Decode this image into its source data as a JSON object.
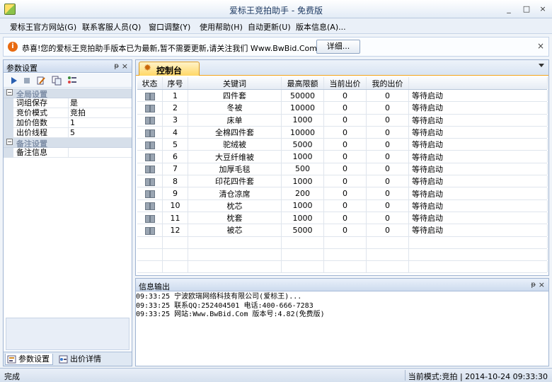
{
  "window": {
    "title": "爱标王竞拍助手 - 免费版",
    "minimize": "_",
    "maximize": "□",
    "close": "×"
  },
  "menu": [
    "爱标王官方网站(G)",
    "联系客服人员(Q)",
    "窗口调整(Y)",
    "使用帮助(H)",
    "自动更新(U)",
    "版本信息(A)..."
  ],
  "info_bar": {
    "icon": "info-icon",
    "text": "恭喜!您的爱标王竞拍助手版本已为最新,暂不需要更新,请关注我们 Www.BwBid.Com",
    "detail_button": "详细...",
    "close": "×"
  },
  "left_panel": {
    "title": "参数设置",
    "pin": "ᵖ",
    "close": "×",
    "categories": [
      {
        "label": "全局设置",
        "props": [
          {
            "name": "词组保存",
            "value": "是"
          },
          {
            "name": "竞价模式",
            "value": "竞拍"
          },
          {
            "name": "加价倍数",
            "value": "1"
          },
          {
            "name": "出价线程",
            "value": "5"
          }
        ]
      },
      {
        "label": "备注设置",
        "props": [
          {
            "name": "备注信息",
            "value": ""
          }
        ]
      }
    ],
    "tabs": [
      "参数设置",
      "出价详情"
    ]
  },
  "main": {
    "tab_label": "控制台",
    "columns": [
      "状态",
      "序号",
      "关键词",
      "最高限额",
      "当前出价",
      "我的出价",
      ""
    ],
    "rows": [
      {
        "no": "1",
        "keyword": "四件套",
        "limit": "50000",
        "current": "0",
        "mine": "0",
        "status": "等待启动"
      },
      {
        "no": "2",
        "keyword": "冬被",
        "limit": "10000",
        "current": "0",
        "mine": "0",
        "status": "等待启动"
      },
      {
        "no": "3",
        "keyword": "床单",
        "limit": "1000",
        "current": "0",
        "mine": "0",
        "status": "等待启动"
      },
      {
        "no": "4",
        "keyword": "全棉四件套",
        "limit": "10000",
        "current": "0",
        "mine": "0",
        "status": "等待启动"
      },
      {
        "no": "5",
        "keyword": "驼绒被",
        "limit": "5000",
        "current": "0",
        "mine": "0",
        "status": "等待启动"
      },
      {
        "no": "6",
        "keyword": "大豆纤维被",
        "limit": "1000",
        "current": "0",
        "mine": "0",
        "status": "等待启动"
      },
      {
        "no": "7",
        "keyword": "加厚毛毯",
        "limit": "500",
        "current": "0",
        "mine": "0",
        "status": "等待启动"
      },
      {
        "no": "8",
        "keyword": "印花四件套",
        "limit": "1000",
        "current": "0",
        "mine": "0",
        "status": "等待启动"
      },
      {
        "no": "9",
        "keyword": "清仓凉席",
        "limit": "200",
        "current": "0",
        "mine": "0",
        "status": "等待启动"
      },
      {
        "no": "10",
        "keyword": "枕芯",
        "limit": "1000",
        "current": "0",
        "mine": "0",
        "status": "等待启动"
      },
      {
        "no": "11",
        "keyword": "枕套",
        "limit": "1000",
        "current": "0",
        "mine": "0",
        "status": "等待启动"
      },
      {
        "no": "12",
        "keyword": "被芯",
        "limit": "5000",
        "current": "0",
        "mine": "0",
        "status": "等待启动"
      }
    ]
  },
  "output": {
    "title": "信息输出",
    "lines": [
      "09:33:25 宁波欧瑞网络科技有限公司(爱标王)...",
      "09:33:25 联系QQ:252404501 电话:400-666-7283",
      "09:33:25 网站:Www.BwBid.Com 版本号:4.82(免费版)"
    ]
  },
  "status_bar": {
    "left": "完成",
    "mode": "当前模式:竞拍",
    "datetime": "2014-10-24 09:33:30"
  }
}
